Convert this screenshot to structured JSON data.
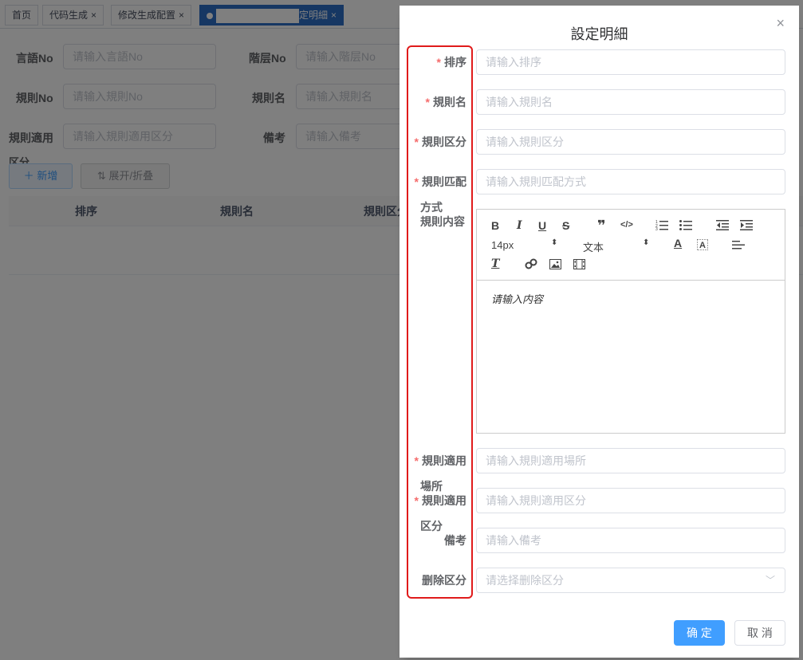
{
  "tabs": [
    {
      "label": "首页"
    },
    {
      "label": "代码生成",
      "close": "×"
    },
    {
      "label": "修改生成配置",
      "close": "×"
    },
    {
      "label": "定明細",
      "close": "×"
    }
  ],
  "query": {
    "lang_label": "言語No",
    "lang_placeholder": "请输入言語No",
    "level_label": "階层No",
    "level_placeholder": "请输入階层No",
    "rule_no_label": "規則No",
    "rule_no_placeholder": "请输入規則No",
    "rule_name_label": "規則名",
    "rule_name_placeholder": "请输入規則名",
    "rule_apply_label_1": "規則適用",
    "rule_apply_label_2": "区分",
    "rule_apply_placeholder": "请输入規則適用区分",
    "remark_label": "備考",
    "remark_placeholder": "请输入備考"
  },
  "actions": {
    "add": "新增",
    "expand": "展开/折叠"
  },
  "table": {
    "headers": [
      "排序",
      "規則名",
      "規則区分"
    ]
  },
  "drawer": {
    "title": "設定明細",
    "close": "×",
    "required_mark": "*",
    "fields": {
      "sort_label": "排序",
      "sort_placeholder": "请输入排序",
      "name_label": "規則名",
      "name_placeholder": "请输入規則名",
      "kind_label": "規則区分",
      "kind_placeholder": "请输入規則区分",
      "match_label_1": "規則匹配",
      "match_label_2": "方式",
      "match_placeholder": "请输入規則匹配方式",
      "content_label": "規則内容",
      "place_label_1": "規則適用",
      "place_label_2": "場所",
      "place_placeholder": "请输入規則適用場所",
      "apply_label_1": "規則適用",
      "apply_label_2": "区分",
      "apply_placeholder": "请输入規則適用区分",
      "remark_label": "備考",
      "remark_placeholder": "请输入備考",
      "delete_label": "删除区分",
      "delete_placeholder": "请选择删除区分"
    },
    "editor": {
      "font_size": "14px",
      "paragraph": "文本",
      "body_placeholder": "请输入内容",
      "tools": {
        "bold": "B",
        "italic": "I",
        "underline": "U",
        "strike": "S",
        "quote": "❞",
        "code": "</>",
        "font_color": "A"
      }
    },
    "ok": "确 定",
    "cancel": "取 消"
  },
  "colors": {
    "primary": "#409eff",
    "active_tab": "#2d6fc6",
    "highlight": "#e01b1b",
    "required": "#f56c6c"
  }
}
